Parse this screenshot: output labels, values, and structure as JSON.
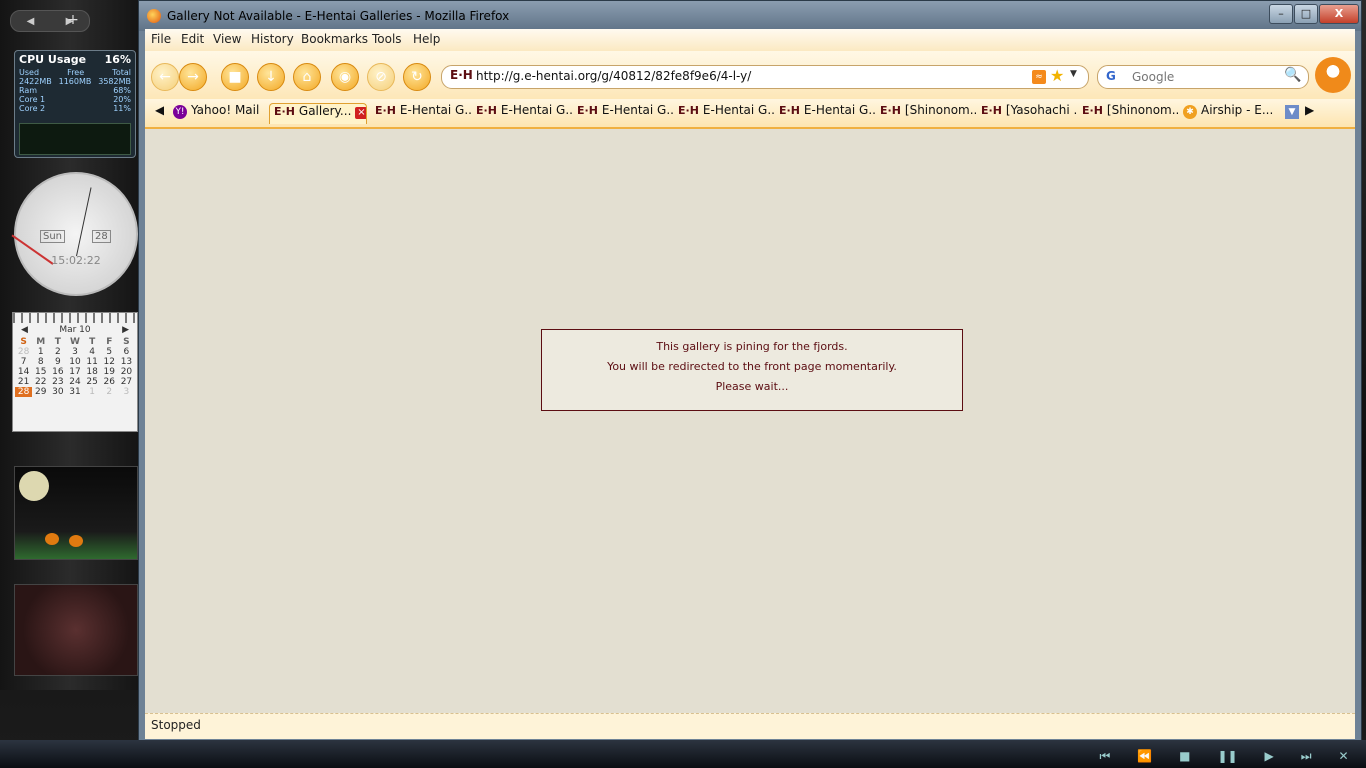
{
  "window": {
    "title": "Gallery Not Available - E-Hentai Galleries - Mozilla Firefox",
    "minimize": "–",
    "maximize": "□",
    "close": "X"
  },
  "menubar": {
    "items": [
      "File",
      "Edit",
      "View",
      "History",
      "Bookmarks",
      "Tools",
      "Help"
    ]
  },
  "navbar": {
    "url": "http://g.e-hentai.org/g/40812/82fe8f9e6/4-l-y/",
    "site_icon": "E·H",
    "search_placeholder": "Google"
  },
  "tabs": [
    {
      "label": "Yahoo! Mail",
      "icon": "yahoo-icon"
    },
    {
      "label": "Gallery...",
      "icon": "eh-icon",
      "selected": true
    },
    {
      "label": "E-Hentai G...",
      "icon": "eh-icon"
    },
    {
      "label": "E-Hentai G...",
      "icon": "eh-icon"
    },
    {
      "label": "E-Hentai G...",
      "icon": "eh-icon"
    },
    {
      "label": "E-Hentai G...",
      "icon": "eh-icon"
    },
    {
      "label": "E-Hentai G...",
      "icon": "eh-icon"
    },
    {
      "label": "[Shinonom...",
      "icon": "eh-icon"
    },
    {
      "label": "[Yasohachi ...",
      "icon": "eh-icon"
    },
    {
      "label": "[Shinonom...",
      "icon": "eh-icon"
    },
    {
      "label": "Airship - E...",
      "icon": "airship-icon"
    }
  ],
  "page": {
    "line1": "This gallery is pining for the fjords.",
    "line2": "You will be redirected to the front page momentarily.",
    "line3": "Please wait..."
  },
  "status": "Stopped",
  "gadgets": {
    "cpu": {
      "title": "CPU Usage",
      "percent": "16%",
      "used_label": "Used",
      "free_label": "Free",
      "total_label": "Total",
      "used": "2422MB",
      "free": "1160MB",
      "total": "3582MB",
      "ram_label": "Ram",
      "ram": "68%",
      "core1_label": "Core 1",
      "core1": "20%",
      "core2_label": "Core 2",
      "core2": "11%"
    },
    "clock": {
      "day": "Sun",
      "date": "28",
      "time": "15:02:22"
    },
    "calendar": {
      "month": "Mar 10",
      "headers": [
        "S",
        "M",
        "T",
        "W",
        "T",
        "F",
        "S"
      ],
      "days": [
        "28",
        "1",
        "2",
        "3",
        "4",
        "5",
        "6",
        "7",
        "8",
        "9",
        "10",
        "11",
        "12",
        "13",
        "14",
        "15",
        "16",
        "17",
        "18",
        "19",
        "20",
        "21",
        "22",
        "23",
        "24",
        "25",
        "26",
        "27",
        "28",
        "29",
        "30",
        "31",
        "1",
        "2",
        "3"
      ],
      "today": "28"
    }
  }
}
